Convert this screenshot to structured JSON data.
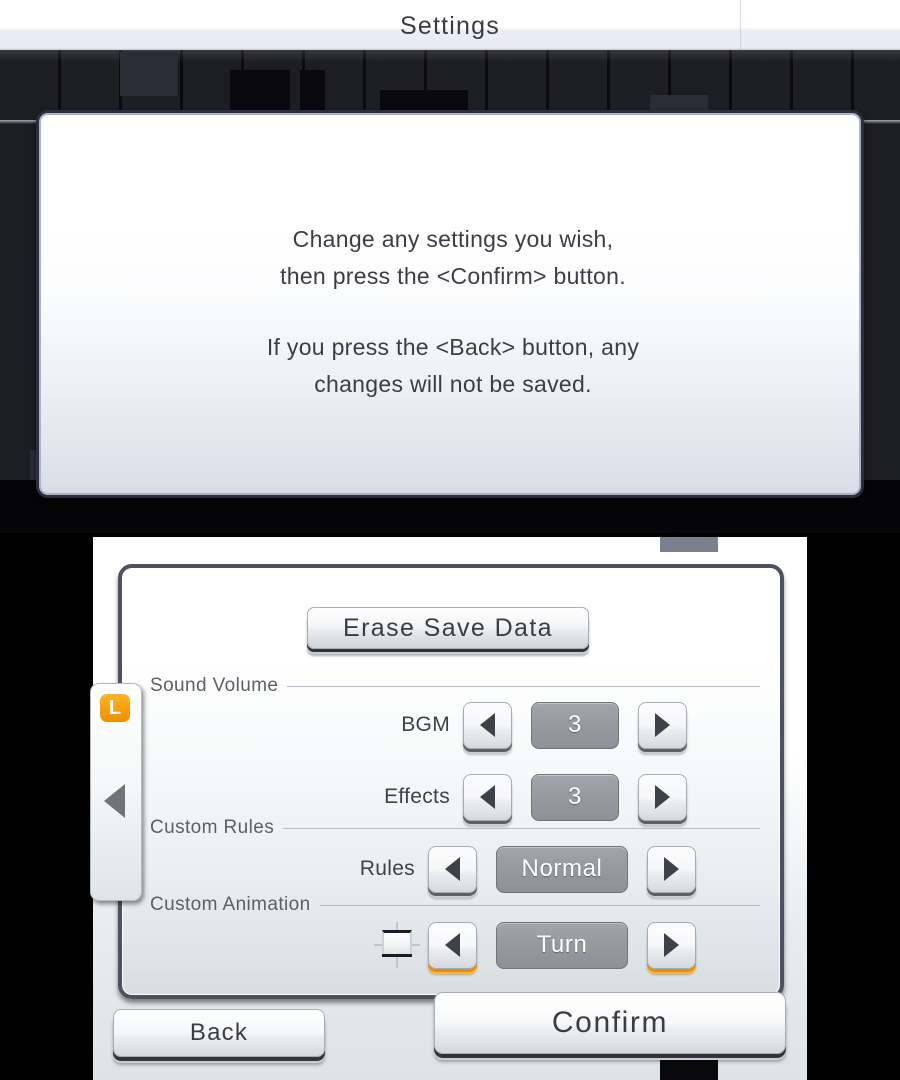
{
  "top_screen": {
    "title": "Settings",
    "dialog": {
      "line1": "Change any settings you wish,",
      "line2": "then press the <Confirm> button.",
      "line3": "If you press the <Back> button, any",
      "line4": "changes will not be saved."
    }
  },
  "bottom_screen": {
    "erase_save_data_label": "Erase Save Data",
    "sections": {
      "sound_volume": "Sound Volume",
      "custom_rules": "Custom Rules",
      "custom_animation": "Custom Animation"
    },
    "settings": [
      {
        "label": "BGM",
        "value": "3"
      },
      {
        "label": "Effects",
        "value": "3"
      },
      {
        "label": "Rules",
        "value": "Normal"
      },
      {
        "label": "",
        "value": "Turn"
      }
    ],
    "side_tab": {
      "shoulder_button": "L"
    },
    "actions": {
      "back_label": "Back",
      "confirm_label": "Confirm"
    }
  },
  "colors": {
    "accent_orange": "#f79e0c",
    "value_grey": "#96999f",
    "panel_border": "#4d5160",
    "text_dark": "#3c3c45"
  }
}
